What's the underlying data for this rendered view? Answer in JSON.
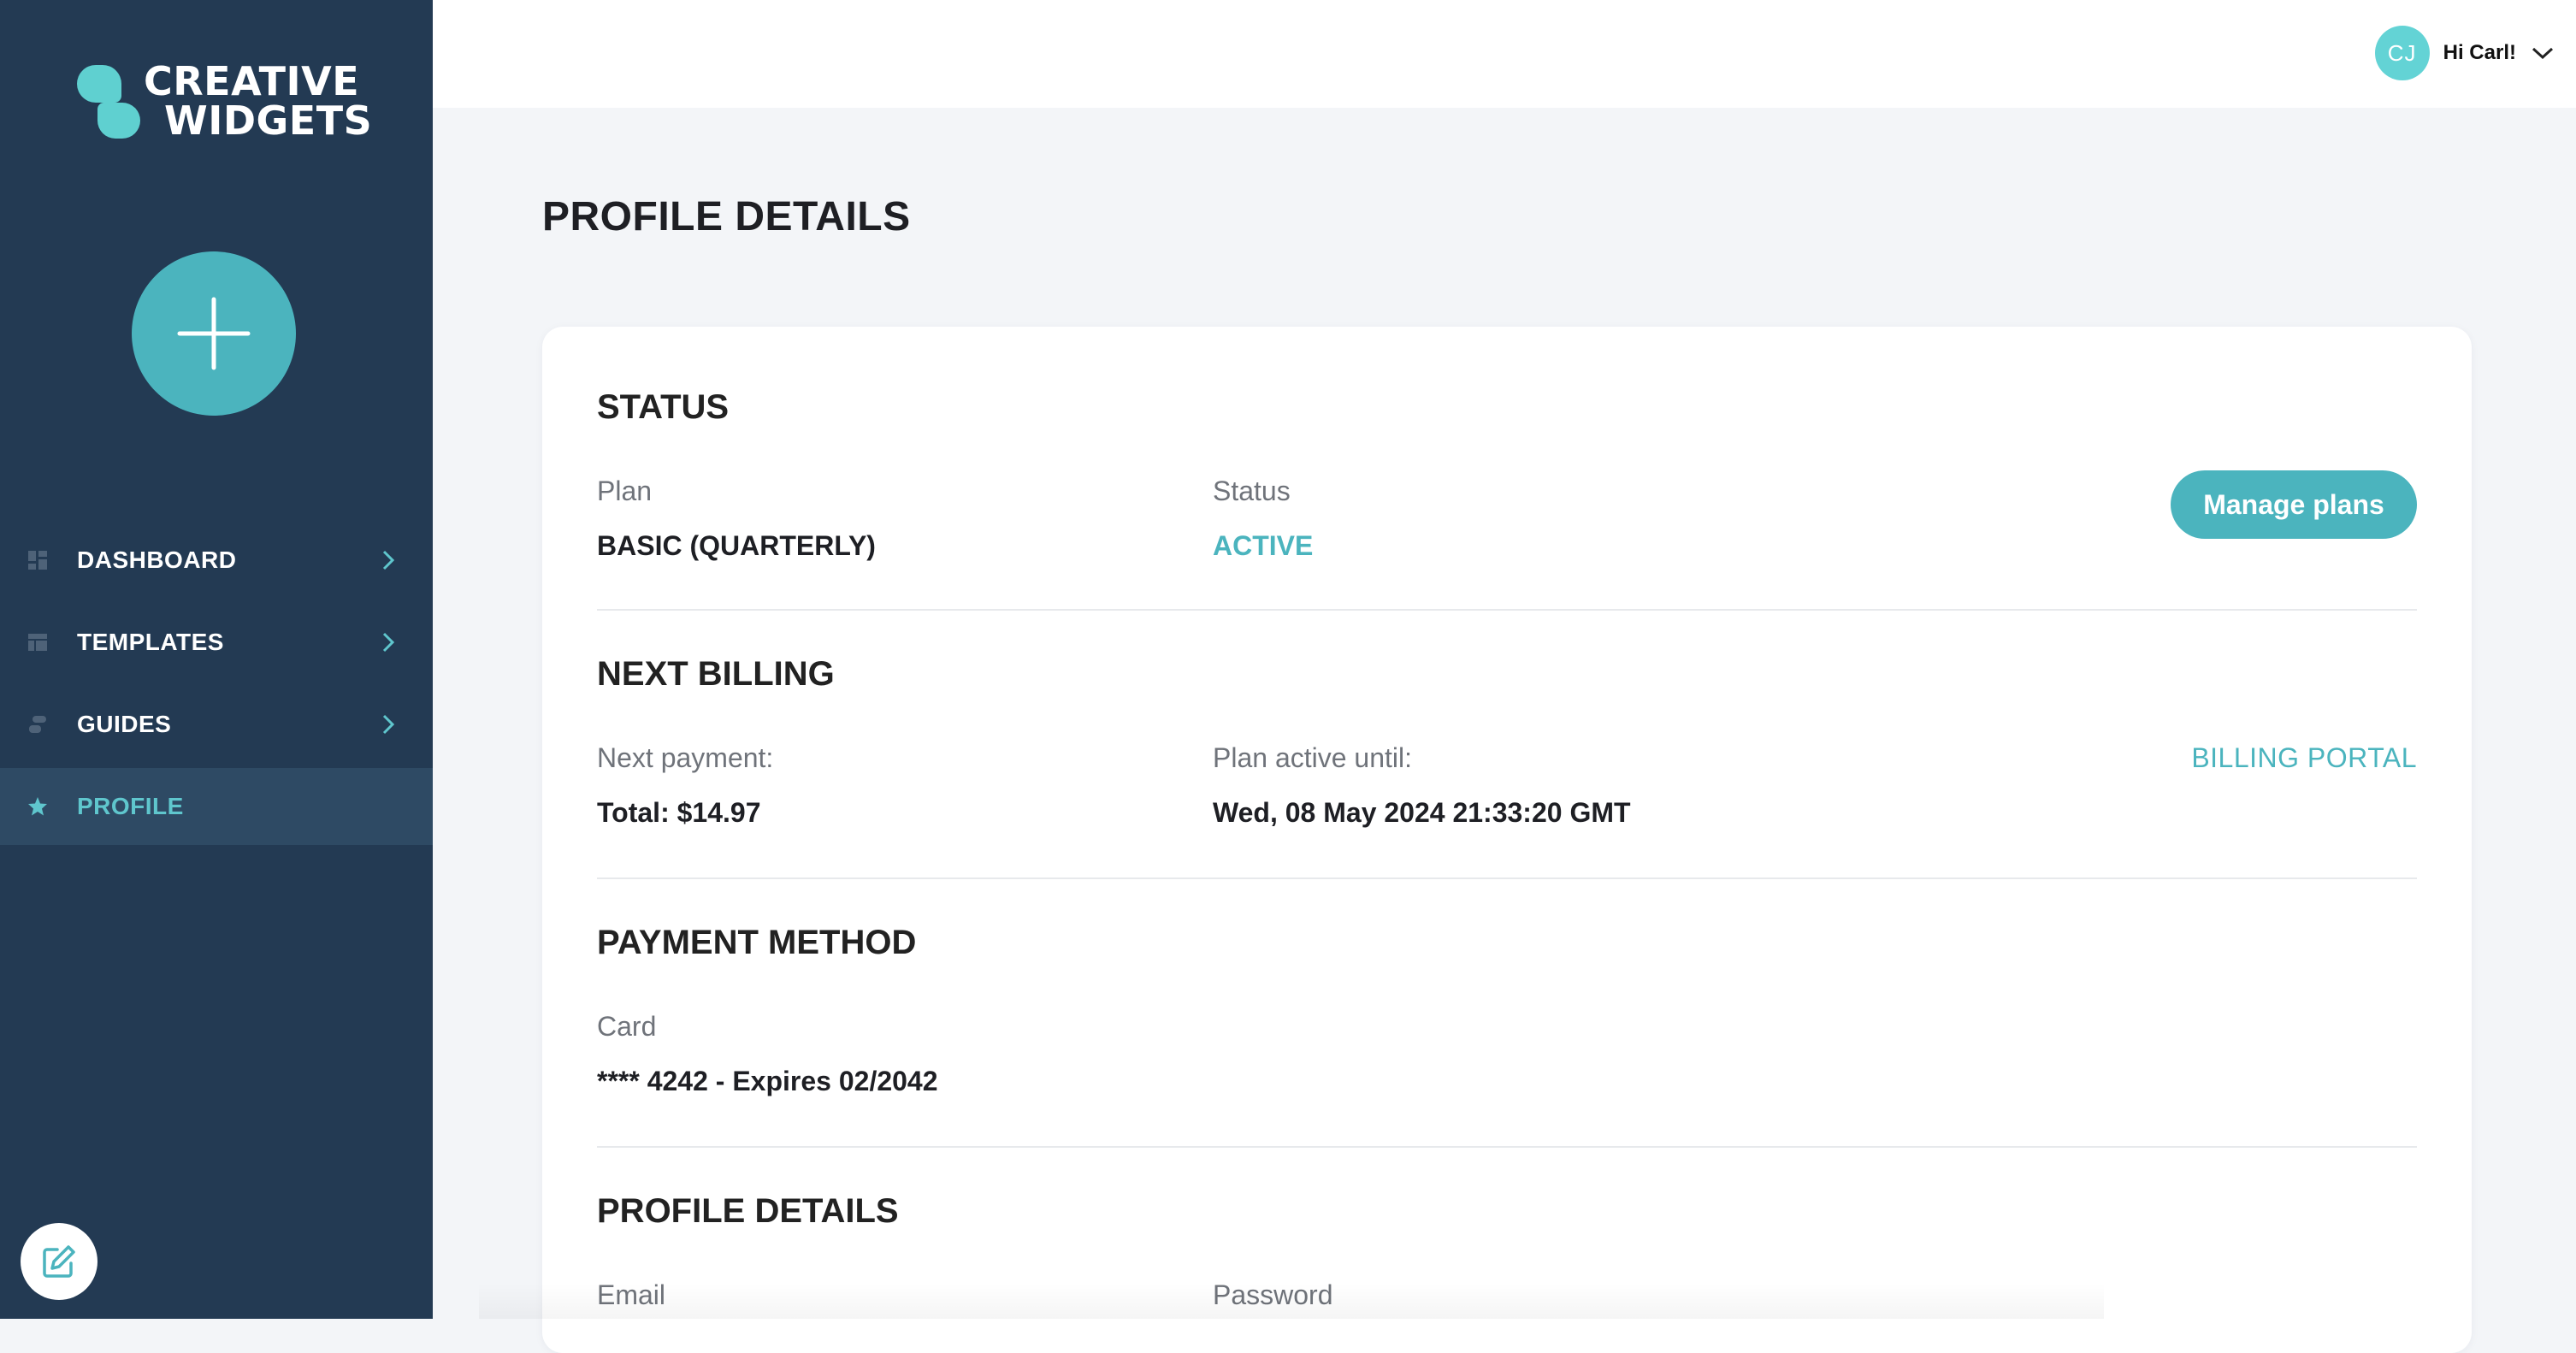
{
  "brand": {
    "line1": "CREATIVE",
    "line2": "WIDGETS",
    "accent_color": "#5fd0d0",
    "sidebar_color": "#233a53",
    "primary_color": "#4bb4be"
  },
  "sidebar": {
    "add_icon": "plus-icon",
    "items": [
      {
        "label": "DASHBOARD",
        "icon": "dashboard-icon",
        "active": false
      },
      {
        "label": "TEMPLATES",
        "icon": "templates-icon",
        "active": false
      },
      {
        "label": "GUIDES",
        "icon": "guides-icon",
        "active": false
      },
      {
        "label": "PROFILE",
        "icon": "star-icon",
        "active": true
      }
    ],
    "fab_icon": "edit-icon"
  },
  "header": {
    "avatar_initials": "CJ",
    "greeting": "Hi Carl!",
    "menu_icon": "chevron-down-icon"
  },
  "main": {
    "page_title": "PROFILE DETAILS",
    "status": {
      "title": "STATUS",
      "plan_label": "Plan",
      "plan_value": "BASIC (QUARTERLY)",
      "status_label": "Status",
      "status_value": "ACTIVE",
      "manage_button": "Manage plans"
    },
    "billing": {
      "title": "NEXT BILLING",
      "next_payment_label": "Next payment:",
      "next_payment_value": "Total: $14.97",
      "active_until_label": "Plan active until:",
      "active_until_value": "Wed, 08 May 2024 21:33:20 GMT",
      "portal_link": "BILLING PORTAL"
    },
    "payment": {
      "title": "PAYMENT METHOD",
      "card_label": "Card",
      "card_value": "**** 4242 - Expires 02/2042"
    },
    "profile": {
      "title": "PROFILE DETAILS",
      "email_label": "Email",
      "password_label": "Password"
    }
  }
}
